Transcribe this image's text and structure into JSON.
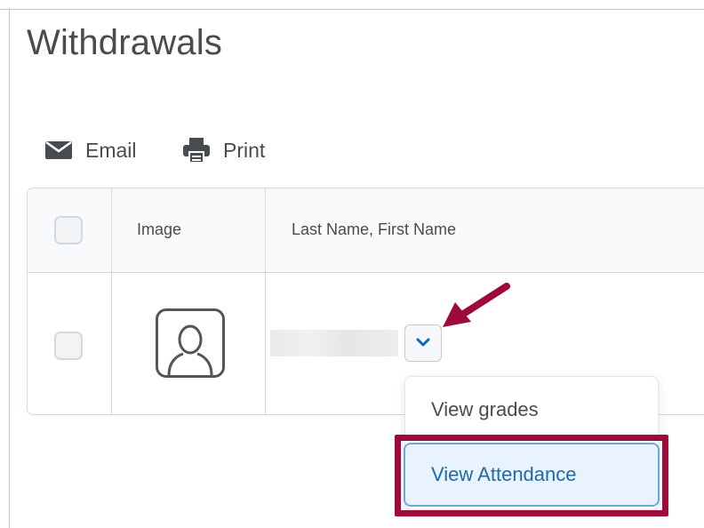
{
  "page": {
    "title": "Withdrawals"
  },
  "toolbar": {
    "email_label": "Email",
    "email_icon": "envelope-icon",
    "print_label": "Print",
    "print_icon": "printer-icon"
  },
  "table": {
    "columns": [
      "Image",
      "Last Name, First Name"
    ],
    "rows": [
      {
        "name": "",
        "avatar_icon": "user-placeholder-icon",
        "context_menu_icon": "chevron-down-icon"
      }
    ]
  },
  "context_menu": {
    "items": [
      "View grades",
      "View Attendance"
    ],
    "highlighted": "View Attendance"
  },
  "annotation": {
    "arrow_color": "#9e0b3b",
    "highlight_color": "#9e0b3b"
  },
  "colors": {
    "accent": "#006fbf",
    "highlight_bg": "#e8f3fd"
  }
}
